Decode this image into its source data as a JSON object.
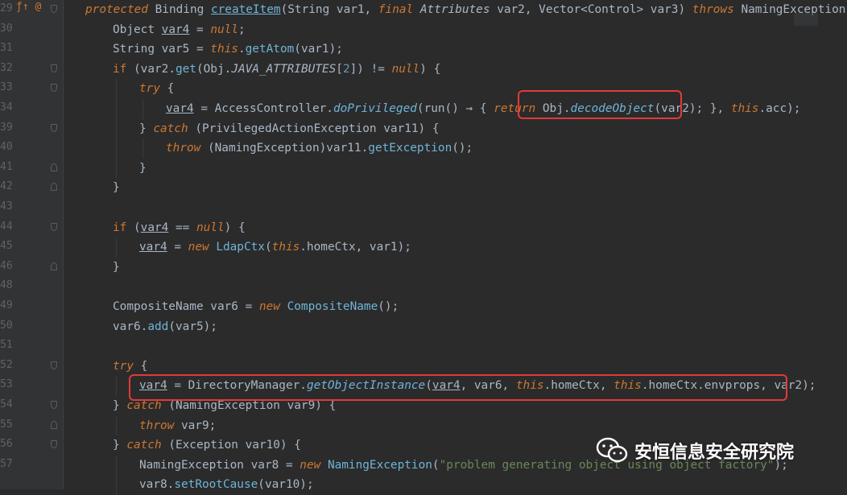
{
  "gutter": {
    "line_numbers": [
      "29",
      "30",
      "31",
      "32",
      "33",
      "34",
      "39",
      "40",
      "41",
      "42",
      "43",
      "44",
      "45",
      "46",
      "48",
      "49",
      "50",
      "51",
      "52",
      "53",
      "54",
      "55",
      "56",
      "57"
    ],
    "first_markers": "ƒ↑ @"
  },
  "code": {
    "lines": [
      [
        [
          "protected ",
          "kw"
        ],
        [
          "Binding ",
          "ty"
        ],
        [
          "createItem",
          "fn ul"
        ],
        [
          "(String var1, ",
          "ty"
        ],
        [
          "final ",
          "kw"
        ],
        [
          "Attributes ",
          "st"
        ],
        [
          "var2, Vector<Control> var3) ",
          "ty"
        ],
        [
          "throws ",
          "kw"
        ],
        [
          "NamingException {",
          "ty"
        ]
      ],
      [
        [
          "Object ",
          "ty"
        ],
        [
          "var4",
          "ul"
        ],
        [
          " = ",
          "ty"
        ],
        [
          "null",
          "kw"
        ],
        [
          ";",
          "ty"
        ]
      ],
      [
        [
          "String var5 = ",
          "ty"
        ],
        [
          "this",
          "kw"
        ],
        [
          ".",
          "ty"
        ],
        [
          "getAtom",
          "call"
        ],
        [
          "(var1);",
          "ty"
        ]
      ],
      [
        [
          "if ",
          "kwn"
        ],
        [
          "(var2.",
          "ty"
        ],
        [
          "get",
          "call"
        ],
        [
          "(Obj.",
          "ty"
        ],
        [
          "JAVA_ATTRIBUTES",
          "st"
        ],
        [
          "[",
          "ty"
        ],
        [
          "2",
          "num"
        ],
        [
          "]) != ",
          "ty"
        ],
        [
          "null",
          "kw"
        ],
        [
          ") {",
          "ty"
        ]
      ],
      [
        [
          "try ",
          "kw"
        ],
        [
          "{",
          "ty"
        ]
      ],
      [
        [
          "var4",
          "ul"
        ],
        [
          " = AccessController.",
          "ty"
        ],
        [
          "doPrivileged",
          "fni"
        ],
        [
          "(run() → { ",
          "ty"
        ],
        [
          "return ",
          "kw"
        ],
        [
          "Obj.",
          "ty"
        ],
        [
          "decodeObject",
          "fni"
        ],
        [
          "(var2); ",
          "ty"
        ],
        [
          "}, ",
          "ty"
        ],
        [
          "this",
          "kw"
        ],
        [
          ".acc);",
          "ty"
        ]
      ],
      [
        [
          "} ",
          "ty"
        ],
        [
          "catch ",
          "kw"
        ],
        [
          "(PrivilegedActionException var11) {",
          "ty"
        ]
      ],
      [
        [
          "throw ",
          "kw"
        ],
        [
          "(NamingException)var11.",
          "ty"
        ],
        [
          "getException",
          "call"
        ],
        [
          "();",
          "ty"
        ]
      ],
      [
        [
          "}",
          "ty"
        ]
      ],
      [
        [
          "}",
          "ty"
        ]
      ],
      [
        [
          "",
          "ty"
        ]
      ],
      [
        [
          "if ",
          "kwn"
        ],
        [
          "(",
          "ty"
        ],
        [
          "var4",
          "ul"
        ],
        [
          " == ",
          "ty"
        ],
        [
          "null",
          "kw"
        ],
        [
          ") {",
          "ty"
        ]
      ],
      [
        [
          "var4",
          "ul"
        ],
        [
          " = ",
          "ty"
        ],
        [
          "new ",
          "kw"
        ],
        [
          "LdapCtx",
          "call"
        ],
        [
          "(",
          "ty"
        ],
        [
          "this",
          "kw"
        ],
        [
          ".homeCtx, var1);",
          "ty"
        ]
      ],
      [
        [
          "}",
          "ty"
        ]
      ],
      [
        [
          "",
          "ty"
        ]
      ],
      [
        [
          "CompositeName var6 = ",
          "ty"
        ],
        [
          "new ",
          "kw"
        ],
        [
          "CompositeName",
          "call"
        ],
        [
          "();",
          "ty"
        ]
      ],
      [
        [
          "var6.",
          "ty"
        ],
        [
          "add",
          "call"
        ],
        [
          "(var5);",
          "ty"
        ]
      ],
      [
        [
          "",
          "ty"
        ]
      ],
      [
        [
          "try ",
          "kw"
        ],
        [
          "{",
          "ty"
        ]
      ],
      [
        [
          "var4",
          "ul"
        ],
        [
          " = DirectoryManager.",
          "ty"
        ],
        [
          "getObjectInstance",
          "fni"
        ],
        [
          "(",
          "ty"
        ],
        [
          "var4",
          "ul"
        ],
        [
          ", var6, ",
          "ty"
        ],
        [
          "this",
          "kw"
        ],
        [
          ".homeCtx, ",
          "ty"
        ],
        [
          "this",
          "kw"
        ],
        [
          ".homeCtx.envprops, var2);",
          "ty"
        ]
      ],
      [
        [
          "} ",
          "ty"
        ],
        [
          "catch ",
          "kw"
        ],
        [
          "(NamingException var9) {",
          "ty"
        ]
      ],
      [
        [
          "throw ",
          "kw"
        ],
        [
          "var9;",
          "ty"
        ]
      ],
      [
        [
          "} ",
          "ty"
        ],
        [
          "catch ",
          "kw"
        ],
        [
          "(Exception var10) {",
          "ty"
        ]
      ],
      [
        [
          "NamingException var8 = ",
          "ty"
        ],
        [
          "new ",
          "kw"
        ],
        [
          "NamingException",
          "call"
        ],
        [
          "(",
          "ty"
        ],
        [
          "\"problem generating object using object factory\"",
          "str"
        ],
        [
          ");",
          "ty"
        ]
      ],
      [
        [
          "var8.",
          "ty"
        ],
        [
          "setRootCause",
          "call"
        ],
        [
          "(var10);",
          "ty"
        ]
      ]
    ]
  },
  "watermark": {
    "text": "安恒信息安全研究院"
  },
  "colors": {
    "background": "#2b2b2b",
    "gutter": "#313335",
    "highlight": "#e23a3a",
    "keyword": "#cc7832",
    "method": "#6fb4d8",
    "string": "#6a8759"
  }
}
